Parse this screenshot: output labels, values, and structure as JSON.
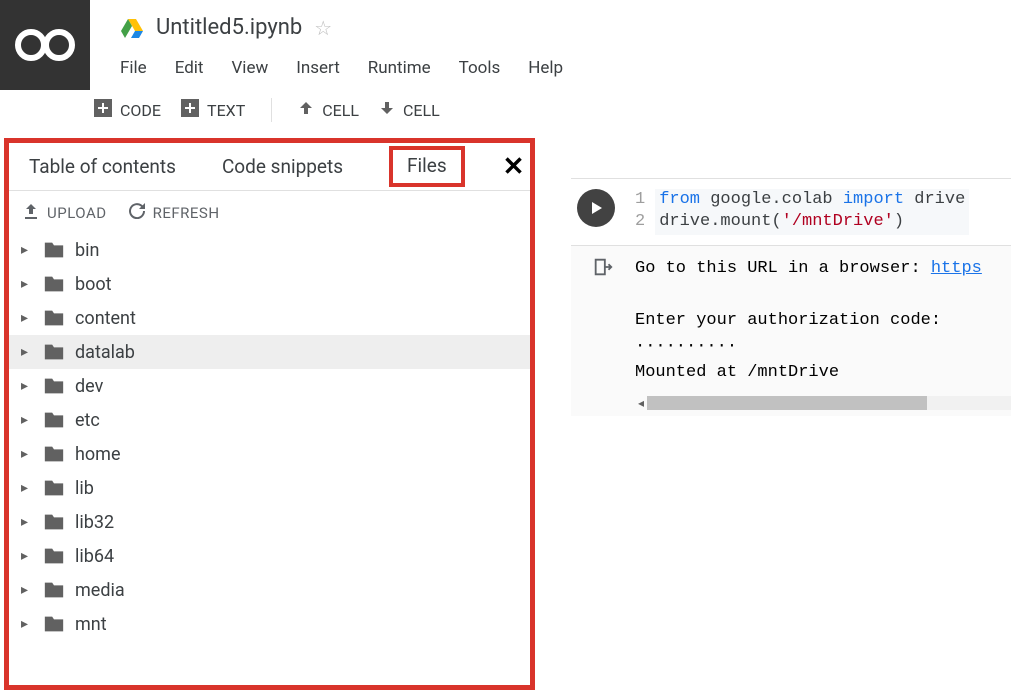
{
  "header": {
    "title": "Untitled5.ipynb",
    "menu": [
      "File",
      "Edit",
      "View",
      "Insert",
      "Runtime",
      "Tools",
      "Help"
    ]
  },
  "toolbar": {
    "code": "CODE",
    "text": "TEXT",
    "cell_up": "CELL",
    "cell_down": "CELL"
  },
  "sidepanel": {
    "tabs": {
      "toc": "Table of contents",
      "snippets": "Code snippets",
      "files": "Files"
    },
    "actions": {
      "upload": "UPLOAD",
      "refresh": "REFRESH"
    },
    "tree": [
      {
        "name": "bin",
        "selected": false
      },
      {
        "name": "boot",
        "selected": false
      },
      {
        "name": "content",
        "selected": false
      },
      {
        "name": "datalab",
        "selected": true
      },
      {
        "name": "dev",
        "selected": false
      },
      {
        "name": "etc",
        "selected": false
      },
      {
        "name": "home",
        "selected": false
      },
      {
        "name": "lib",
        "selected": false
      },
      {
        "name": "lib32",
        "selected": false
      },
      {
        "name": "lib64",
        "selected": false
      },
      {
        "name": "media",
        "selected": false
      },
      {
        "name": "mnt",
        "selected": false
      }
    ]
  },
  "code": {
    "line1_a": "from",
    "line1_b": " google.colab ",
    "line1_c": "import",
    "line1_d": " drive",
    "line2_a": "drive.mount(",
    "line2_b": "'/mntDrive'",
    "line2_c": ")"
  },
  "output": {
    "line1_a": "Go to this URL in a browser: ",
    "line1_link": "https",
    "blank": "",
    "line2": "Enter your authorization code:",
    "line3": "··········",
    "line4": "Mounted at /mntDrive"
  }
}
